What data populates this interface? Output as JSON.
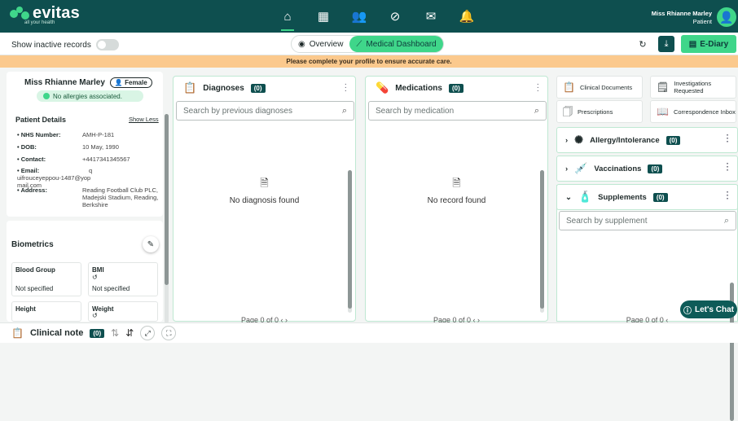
{
  "brand": {
    "name": "evitas",
    "tagline": "all your health"
  },
  "nav": {
    "icons": [
      "home-icon",
      "calendar-icon",
      "people-icon",
      "link-icon",
      "mail-icon",
      "bell-icon"
    ]
  },
  "user": {
    "name": "Miss Rhianne Marley",
    "role": "Patient"
  },
  "toolbar": {
    "inactive_label": "Show inactive records",
    "overview_label": "Overview",
    "dashboard_label": "Medical Dashboard",
    "ediary_label": "E-Diary"
  },
  "banner": {
    "text": "Please complete your profile to ensure accurate care."
  },
  "patient": {
    "name": "Miss Rhianne Marley",
    "gender": "Female",
    "allergy_status": "No allergies associated.",
    "details_title": "Patient Details",
    "show_less": "Show Less",
    "details": [
      {
        "label": "NHS Number:",
        "value": "AMH-P-181"
      },
      {
        "label": "DOB:",
        "value": "10 May, 1990"
      },
      {
        "label": "Contact:",
        "value": "+4417341345567"
      },
      {
        "label": "Email:",
        "value": "quifrouceyeppou-1487@yopmail.com"
      },
      {
        "label": "Address:",
        "value": "Reading Football Club PLC, Madejski Stadium, Reading, Berkshire"
      }
    ]
  },
  "biometrics": {
    "title": "Biometrics",
    "items": [
      {
        "label": "Blood Group",
        "value": "Not specified"
      },
      {
        "label": "BMI",
        "value": "Not specified"
      },
      {
        "label": "Height",
        "value": ""
      },
      {
        "label": "Weight",
        "value": ""
      }
    ]
  },
  "diagnoses": {
    "title": "Diagnoses",
    "count": "(0)",
    "placeholder": "Search by previous diagnoses",
    "empty": "No diagnosis found",
    "pager": "Page 0 of 0"
  },
  "medications": {
    "title": "Medications",
    "count": "(0)",
    "placeholder": "Search by medication",
    "empty": "No record found",
    "pager": "Page 0 of 0"
  },
  "quick_links": [
    {
      "label": "Clinical Documents",
      "icon": "clipboard-icon"
    },
    {
      "label": "Investigations Requested",
      "icon": "search-doc-icon"
    },
    {
      "label": "Prescriptions",
      "icon": "prescription-icon"
    },
    {
      "label": "Correspondence Inbox",
      "icon": "book-icon"
    }
  ],
  "accordions": [
    {
      "title": "Allergy/Intolerance",
      "count": "(0)",
      "icon": "virus-icon"
    },
    {
      "title": "Vaccinations",
      "count": "(0)",
      "icon": "syringe-icon"
    },
    {
      "title": "Supplements",
      "count": "(0)",
      "icon": "supplement-icon"
    }
  ],
  "supplements": {
    "placeholder": "Search by supplement",
    "pager": "Page 0 of 0"
  },
  "chat": {
    "label": "Let's Chat"
  },
  "clinical_note": {
    "label": "Clinical note",
    "count": "(0)"
  },
  "colors": {
    "brand_dark": "#0e4f4f",
    "accent": "#3fd68a",
    "banner": "#fbc98d"
  }
}
